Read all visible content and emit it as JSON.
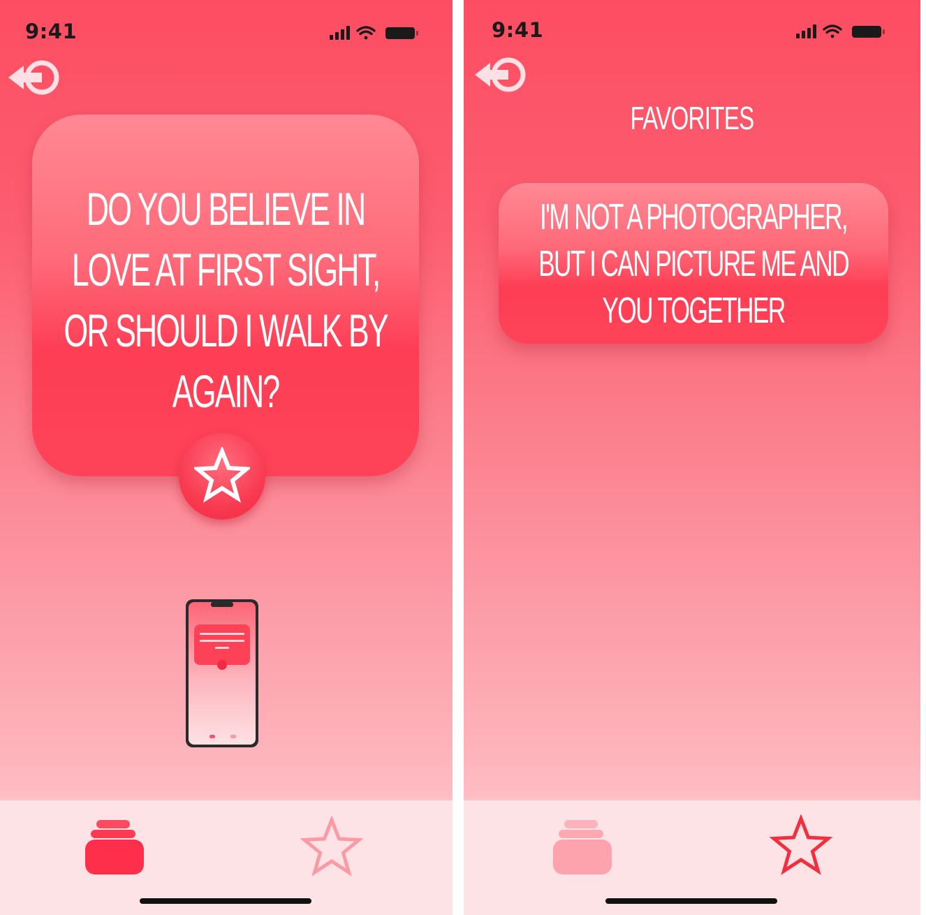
{
  "colors": {
    "accent": "#fd3e55",
    "background_top": "#fd4d62",
    "background_bottom": "#febfc5",
    "tab_bar": "#fde3e5",
    "tab_inactive": "#f99aa5",
    "tab_active": "#f1303f"
  },
  "screens": [
    {
      "status_bar": {
        "time": "9:41"
      },
      "back_button": {
        "icon": "back-arrow-icon"
      },
      "card": {
        "text": "DO YOU BELIEVE IN\nLOVE AT FIRST SIGHT,\nOR SHOULD I WALK BY\nAGAIN?"
      },
      "favorite_button": {
        "icon": "star-icon"
      },
      "preview": {
        "icon": "phone-preview-icon"
      },
      "tab_bar": {
        "tabs": [
          {
            "icon": "card-stack-icon",
            "selected": true
          },
          {
            "icon": "star-outline-icon",
            "selected": false
          }
        ]
      }
    },
    {
      "status_bar": {
        "time": "9:41"
      },
      "back_button": {
        "icon": "back-arrow-icon"
      },
      "title": "FAVORITES",
      "favorites": [
        {
          "text": "I'M NOT A PHOTOGRAPHER,\nBUT I CAN PICTURE ME AND\nYOU TOGETHER"
        }
      ],
      "tab_bar": {
        "tabs": [
          {
            "icon": "card-stack-icon",
            "selected": false
          },
          {
            "icon": "star-outline-icon",
            "selected": true
          }
        ]
      }
    }
  ]
}
